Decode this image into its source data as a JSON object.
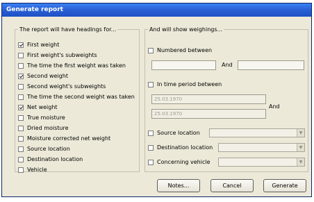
{
  "window": {
    "title": "Generate report"
  },
  "headings": {
    "legend": "The report will have headings for...",
    "items": [
      {
        "label": "First weight",
        "checked": true
      },
      {
        "label": "First weight's subweights",
        "checked": false
      },
      {
        "label": "The time the first weight was taken",
        "checked": false
      },
      {
        "label": "Second weight",
        "checked": true
      },
      {
        "label": "Second weight's subweights",
        "checked": false
      },
      {
        "label": "The time the second weight was taken",
        "checked": false
      },
      {
        "label": "Net weight",
        "checked": true
      },
      {
        "label": "True moisture",
        "checked": false
      },
      {
        "label": "Dried moisture",
        "checked": false
      },
      {
        "label": "Moisture corrected net weight",
        "checked": false
      },
      {
        "label": "Source location",
        "checked": false
      },
      {
        "label": "Destination location",
        "checked": false
      },
      {
        "label": "Vehicle",
        "checked": false
      }
    ]
  },
  "filters": {
    "legend": "And will show weighings...",
    "numbered_between": {
      "label": "Numbered between",
      "checked": false,
      "and_label": "And",
      "from": "",
      "to": ""
    },
    "time_period": {
      "label": "In time period between",
      "checked": false,
      "and_label": "And",
      "from": "25.03.1970",
      "to": "25.03.1970"
    },
    "source_location": {
      "label": "Source location",
      "checked": false,
      "value": ""
    },
    "destination_location": {
      "label": "Destination location",
      "checked": false,
      "value": ""
    },
    "concerning_vehicle": {
      "label": "Concerning vehicle",
      "checked": false,
      "value": ""
    }
  },
  "buttons": {
    "notes": "Notes...",
    "cancel": "Cancel",
    "generate": "Generate"
  },
  "icons": {
    "dropdown": "chevron-down-icon",
    "checkmark": "checkmark-icon"
  },
  "colors": {
    "titlebar": "#2a62d6",
    "dialog_bg": "#ece9d8"
  }
}
